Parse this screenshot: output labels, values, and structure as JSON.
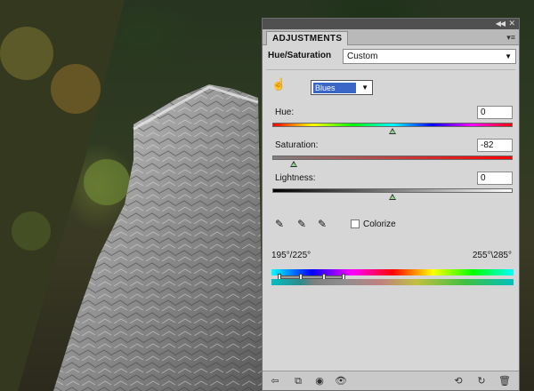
{
  "panel": {
    "tab_label": "ADJUSTMENTS",
    "adjustment_name": "Hue/Saturation",
    "preset_value": "Custom",
    "channel_value": "Blues"
  },
  "sliders": {
    "hue": {
      "label": "Hue:",
      "value": "0",
      "position": 0.5
    },
    "saturation": {
      "label": "Saturation:",
      "value": "-82",
      "position": 0.09
    },
    "lightness": {
      "label": "Lightness:",
      "value": "0",
      "position": 0.5
    }
  },
  "colorize": {
    "label": "Colorize",
    "checked": false
  },
  "range": {
    "left": "195°/225°",
    "right": "255°\\285°"
  },
  "icons": {
    "hand": "hand-tool-icon",
    "eyedropper": "eyedropper-icon",
    "eyedropper_plus": "eyedropper-plus-icon",
    "eyedropper_minus": "eyedropper-minus-icon"
  }
}
